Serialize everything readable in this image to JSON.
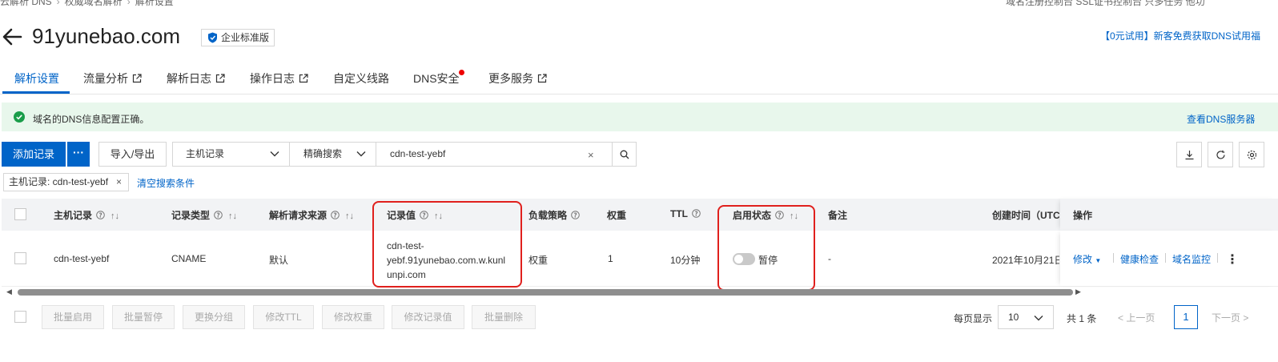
{
  "breadcrumb": [
    "云解析 DNS",
    "权威域名解析",
    "解析设置"
  ],
  "top_right_text": "域名注册控制台   SSL证书控制台   只多任务 他功",
  "header": {
    "domain": "91yunebao.com",
    "badge": "企业标准版",
    "promo": "【0元试用】新客免费获取DNS试用福"
  },
  "tabs": [
    {
      "label": "解析设置",
      "external": false
    },
    {
      "label": "流量分析",
      "external": true
    },
    {
      "label": "解析日志",
      "external": true
    },
    {
      "label": "操作日志",
      "external": true
    },
    {
      "label": "自定义线路",
      "external": false
    },
    {
      "label": "DNS安全",
      "external": false,
      "dot": true
    },
    {
      "label": "更多服务",
      "external": true
    }
  ],
  "alert": {
    "text": "域名的DNS信息配置正确。",
    "link": "查看DNS服务器"
  },
  "toolbar": {
    "add_label": "添加记录",
    "more_label": "···",
    "import_label": "导入/导出",
    "field_select": "主机记录",
    "match_select": "精确搜索",
    "search_value": "cdn-test-yebf",
    "clear": "×"
  },
  "filter": {
    "tag": "主机记录: cdn-test-yebf",
    "tag_close": "×",
    "clear_label": "清空搜索条件"
  },
  "table": {
    "columns": [
      "主机记录",
      "记录类型",
      "解析请求来源",
      "记录值",
      "负载策略",
      "权重",
      "TTL",
      "启用状态",
      "备注",
      "创建时间（UTC-",
      "操作"
    ],
    "rows": [
      {
        "host": "cdn-test-yebf",
        "type": "CNAME",
        "source": "默认",
        "value_lines": [
          "cdn-test-",
          "yebf.91yunebao.com.w.kunl",
          "unpi.com"
        ],
        "strategy": "权重",
        "weight": "1",
        "ttl": "10分钟",
        "status": "暂停",
        "status_on": false,
        "remark": "-",
        "created": "2021年10月21日",
        "ops": [
          "修改",
          "健康检查",
          "域名监控"
        ]
      }
    ]
  },
  "bulk_actions": [
    "批量启用",
    "批量暂停",
    "更换分组",
    "修改TTL",
    "修改权重",
    "修改记录值",
    "批量删除"
  ],
  "pager": {
    "per_page_label": "每页显示",
    "per_page": "10",
    "total": "共 1 条",
    "prev": "上一页",
    "page": "1",
    "next": "下一页"
  },
  "colors": {
    "accent": "#0064c8",
    "highlight": "#e0201d",
    "success_bg": "#e8f7ec"
  }
}
